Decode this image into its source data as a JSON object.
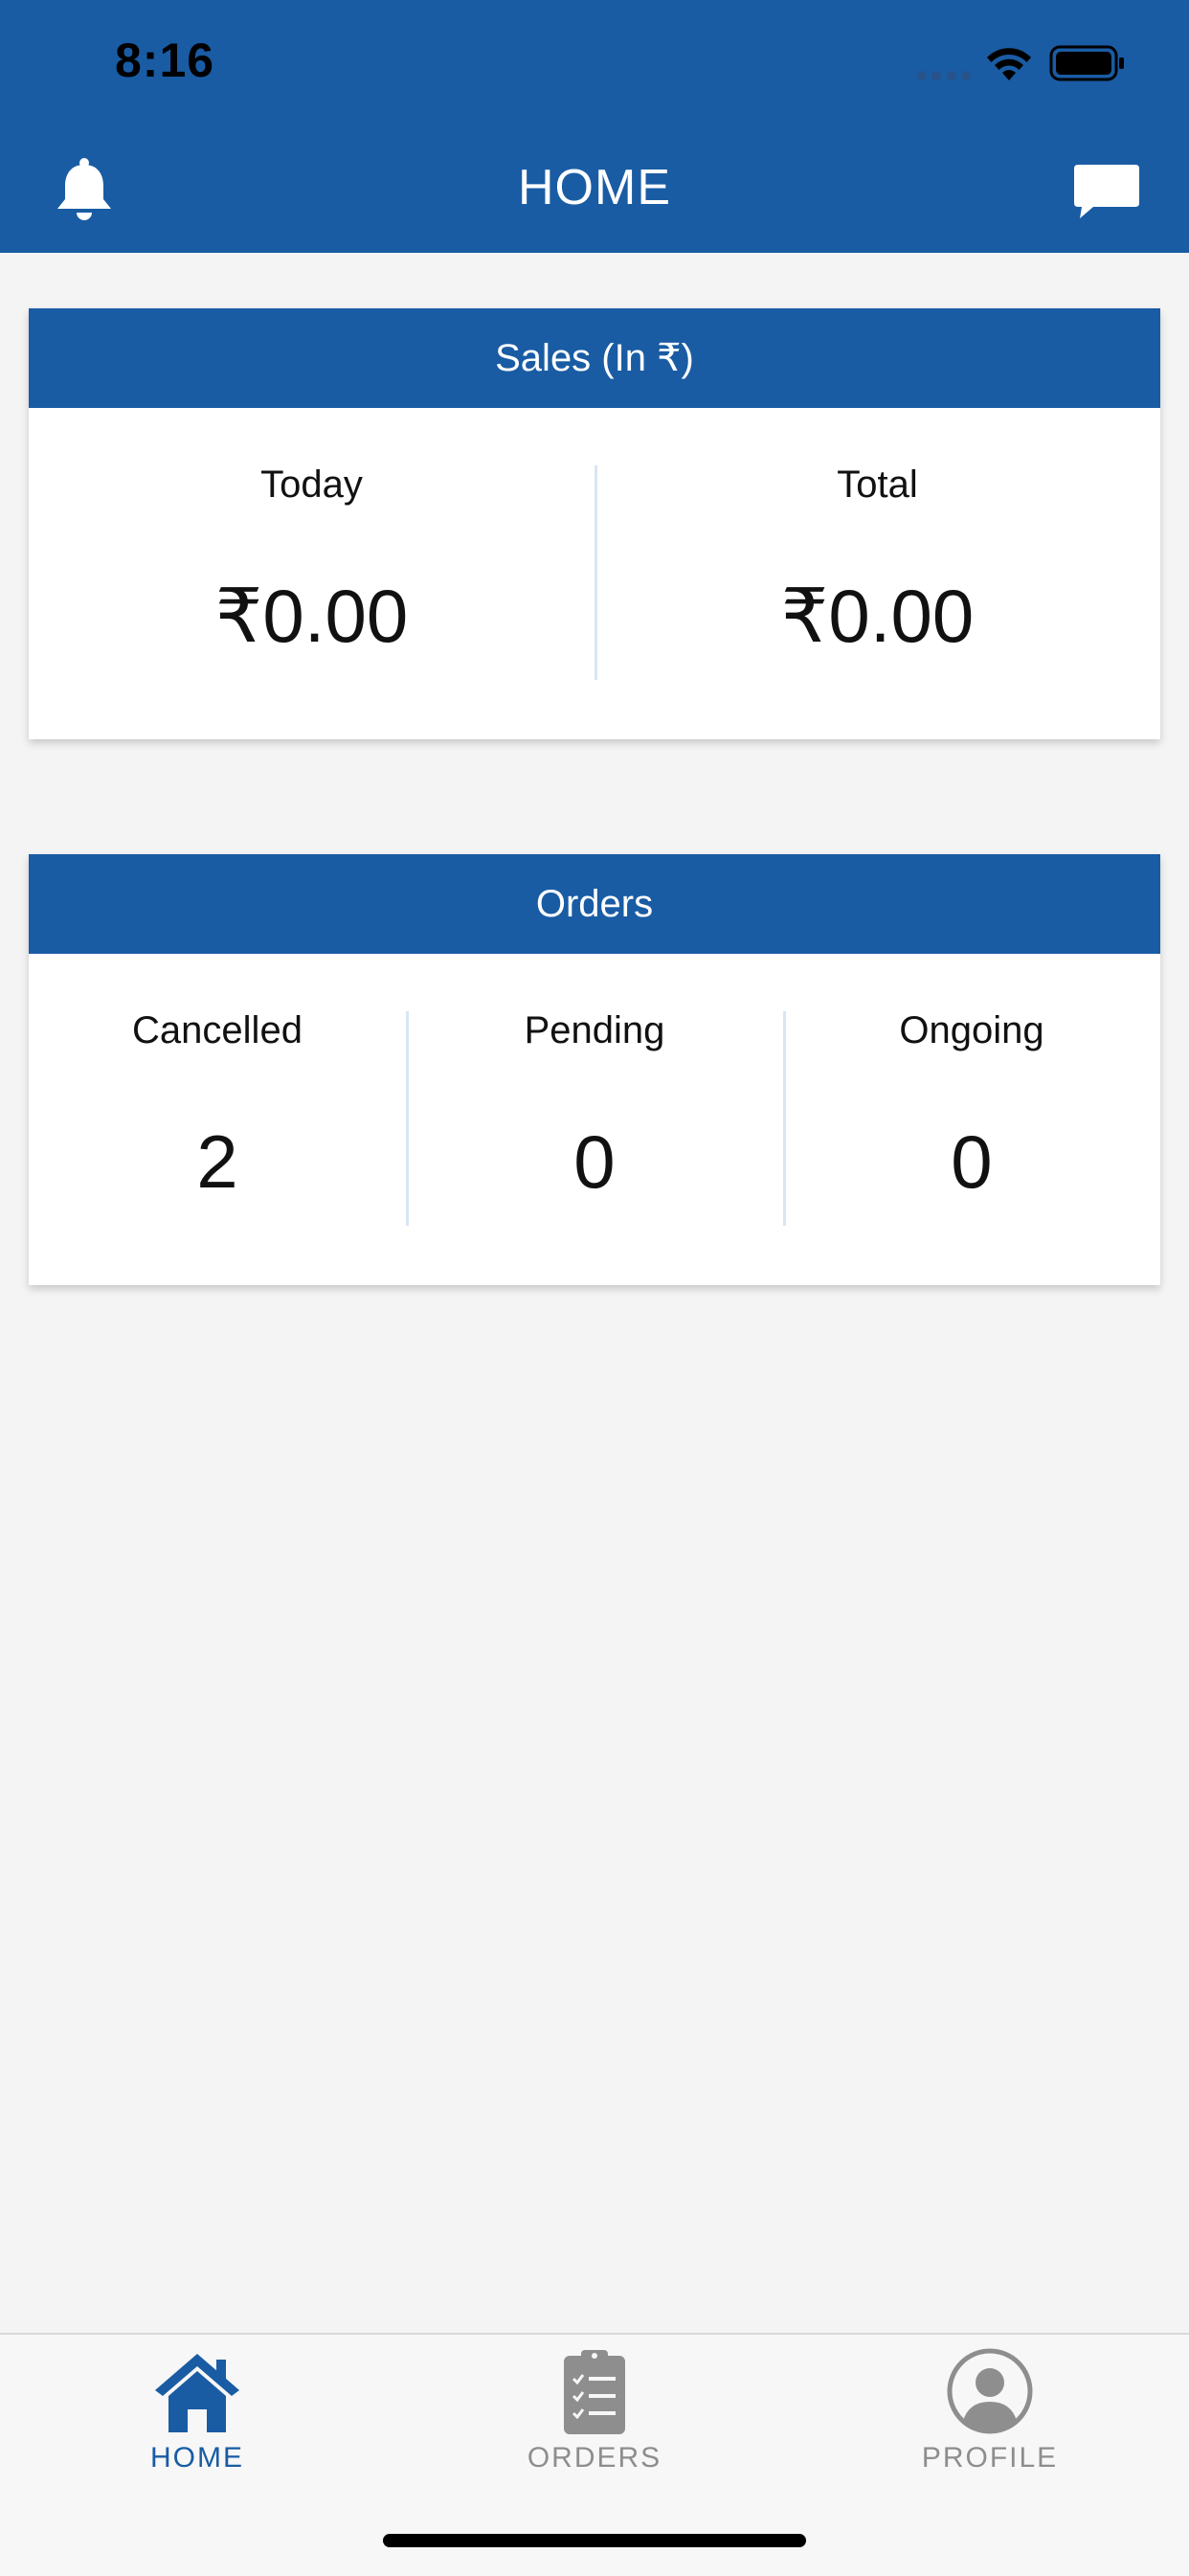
{
  "status_bar": {
    "time": "8:16"
  },
  "header": {
    "title": "HOME",
    "left_icon": "bell-icon",
    "right_icon": "chat-icon"
  },
  "sales": {
    "title": "Sales (In ₹)",
    "today_label": "Today",
    "today_value": "₹0.00",
    "total_label": "Total",
    "total_value": "₹0.00"
  },
  "orders": {
    "title": "Orders",
    "cancelled_label": "Cancelled",
    "cancelled_value": "2",
    "pending_label": "Pending",
    "pending_value": "0",
    "ongoing_label": "Ongoing",
    "ongoing_value": "0"
  },
  "tabbar": {
    "items": [
      {
        "label": "HOME",
        "icon": "home-icon",
        "active": true
      },
      {
        "label": "ORDERS",
        "icon": "clipboard-icon",
        "active": false
      },
      {
        "label": "PROFILE",
        "icon": "profile-icon",
        "active": false
      }
    ]
  },
  "colors": {
    "primary": "#195ca4",
    "background": "#f4f4f4",
    "inactive_tab": "#8e8e8e",
    "divider": "#d8e6f3"
  }
}
